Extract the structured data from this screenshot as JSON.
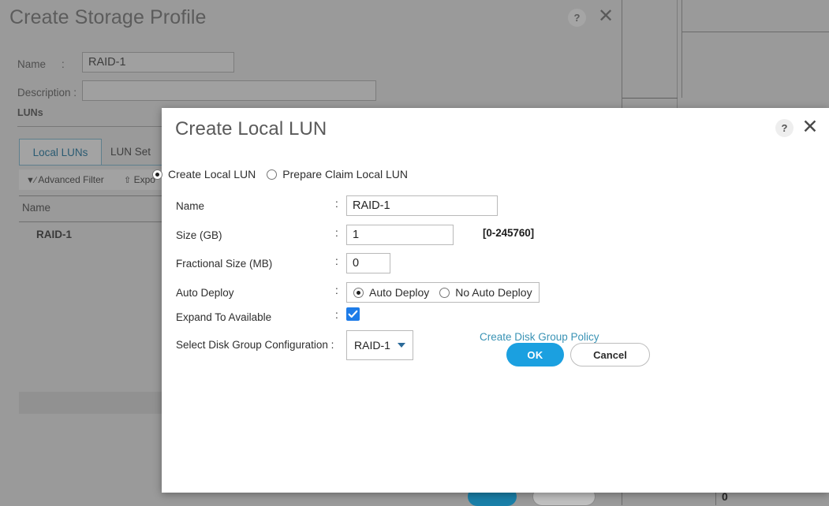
{
  "background_dialog": {
    "title": "Create Storage Profile",
    "help_icon": "?",
    "close_icon": "✕",
    "fields": [
      {
        "label": "Name",
        "colon": ":",
        "value": "RAID-1"
      },
      {
        "label": "Description :",
        "colon": "",
        "value": ""
      }
    ],
    "section_label": "LUNs",
    "tabs": [
      {
        "label": "Local LUNs",
        "selected": true
      },
      {
        "label": "LUN Set",
        "selected": false
      }
    ],
    "toolbar": [
      {
        "label": "Advanced Filter",
        "icon": "filter-icon"
      },
      {
        "label": "Expo",
        "icon": "export-icon"
      }
    ],
    "table": {
      "columns": [
        "Name"
      ],
      "rows": [
        [
          "RAID-1"
        ]
      ]
    },
    "footer_value": "0",
    "footer_colon": ":"
  },
  "modal": {
    "title": "Create Local LUN",
    "help_icon": "?",
    "close_icon": "✕",
    "mode_options": [
      {
        "label": "Create Local LUN",
        "selected": true
      },
      {
        "label": "Prepare Claim Local LUN",
        "selected": false
      }
    ],
    "rows": {
      "name": {
        "label": "Name",
        "colon": ":",
        "value": "RAID-1"
      },
      "size": {
        "label": "Size (GB)",
        "colon": ":",
        "value": "1",
        "hint": "[0-245760]"
      },
      "fractional_size": {
        "label": "Fractional Size (MB)",
        "colon": ":",
        "value": "0"
      },
      "auto_deploy": {
        "label": "Auto Deploy",
        "colon": ":",
        "options": [
          {
            "label": "Auto Deploy",
            "selected": true
          },
          {
            "label": "No Auto Deploy",
            "selected": false
          }
        ]
      },
      "expand_to_available": {
        "label": "Expand To Available",
        "colon": ":",
        "checked": true
      },
      "disk_group": {
        "label": "Select Disk Group Configuration :",
        "value": "RAID-1",
        "caret": "▼",
        "link_label": "Create Disk Group Policy"
      }
    },
    "buttons": {
      "ok": "OK",
      "cancel": "Cancel"
    }
  },
  "colors": {
    "accent_blue": "#1ba0e0",
    "link_teal": "#3a93b5",
    "checkbox_blue": "#1e7ce8",
    "tab_active": "#2a5b72",
    "backdrop_gray": "#9a9a9a"
  }
}
